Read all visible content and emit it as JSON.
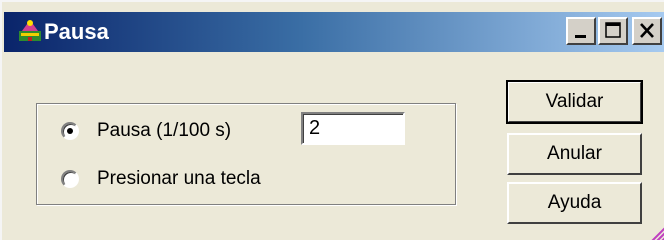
{
  "window": {
    "title": "Pausa",
    "icon": "app-icon",
    "controls": [
      "minimize-icon",
      "maximize-icon",
      "close-icon"
    ]
  },
  "options": {
    "pause": {
      "label": "Pausa (1/100 s)",
      "selected": true,
      "value": "2"
    },
    "keypress": {
      "label": "Presionar una tecla",
      "selected": false
    }
  },
  "buttons": {
    "validar": "Validar",
    "anular": "Anular",
    "ayuda": "Ayuda"
  },
  "colors": {
    "title_gradient_start": "#0a246a",
    "title_gradient_end": "#a6caf0",
    "face": "#ece9d8"
  }
}
